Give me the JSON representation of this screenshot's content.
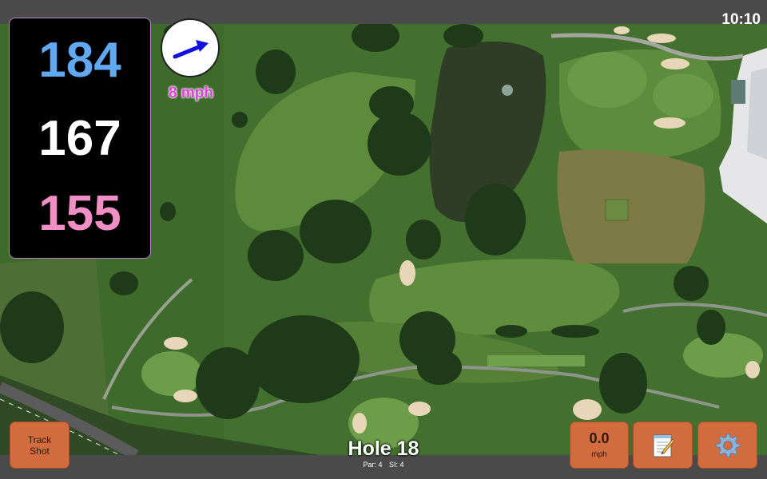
{
  "status_bar": {
    "clock": "10:10"
  },
  "distances": {
    "back": "184",
    "middle": "167",
    "front": "155"
  },
  "wind": {
    "label": "8 mph",
    "direction_icon": "wind-arrow-icon",
    "arrow_color": "#1010e0"
  },
  "buttons": {
    "track_shot": "Track\nShot",
    "speed_value": "0.0",
    "speed_unit": "mph",
    "notes_icon": "notepad-icon",
    "settings_icon": "gear-icon"
  },
  "hole": {
    "title": "Hole 18",
    "par": "Par: 4",
    "si": "SI: 4"
  },
  "colors": {
    "back_distance": "#62a8f0",
    "middle_distance": "#ffffff",
    "front_distance": "#f08ec6",
    "wind_label": "#e33fe0",
    "button": "#d26b3e",
    "panel_border": "#b889c2"
  }
}
